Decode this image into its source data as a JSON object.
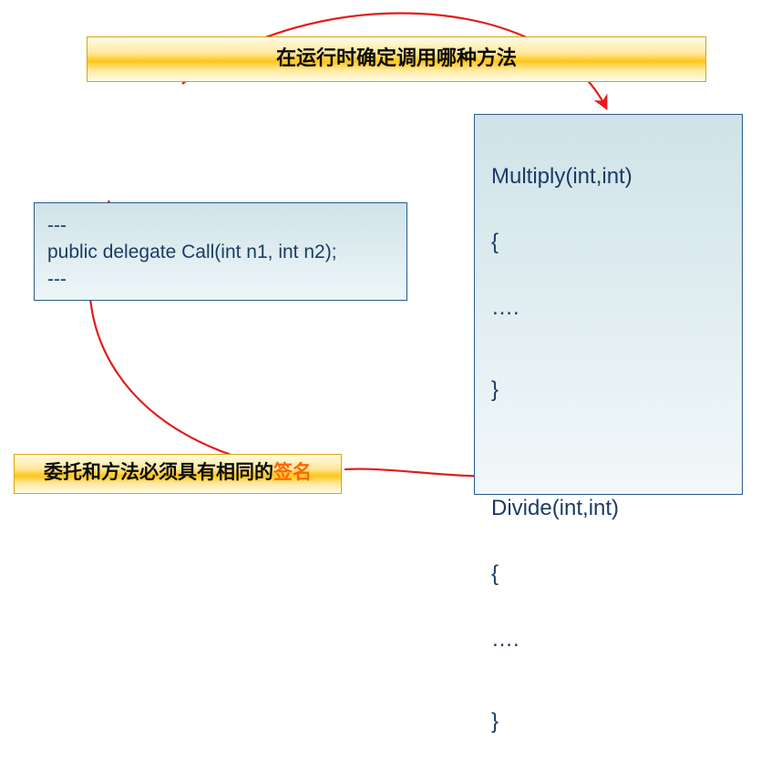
{
  "top_banner": "在运行时确定调用哪种方法",
  "left_box": {
    "line1": "---",
    "line2": "public delegate Call(int n1, int n2);",
    "line3": "---"
  },
  "right_box": {
    "m1_sig": "Multiply(int,int)",
    "open1": "{",
    "body1": "….",
    "close1": "}",
    "m2_sig": "Divide(int,int)",
    "open2": "{",
    "body2": "….",
    "close2": "}"
  },
  "bottom_banner": {
    "prefix": "委托和方法必须具有相同的",
    "highlight": "签名"
  },
  "arrows": {
    "color": "#e31b1b",
    "top_arrow": "Arc from top banner to upper-right box, indicating runtime method selection",
    "bottom_arrow": "Arc from bottom banner to lower-right box, indicating matching signature"
  }
}
